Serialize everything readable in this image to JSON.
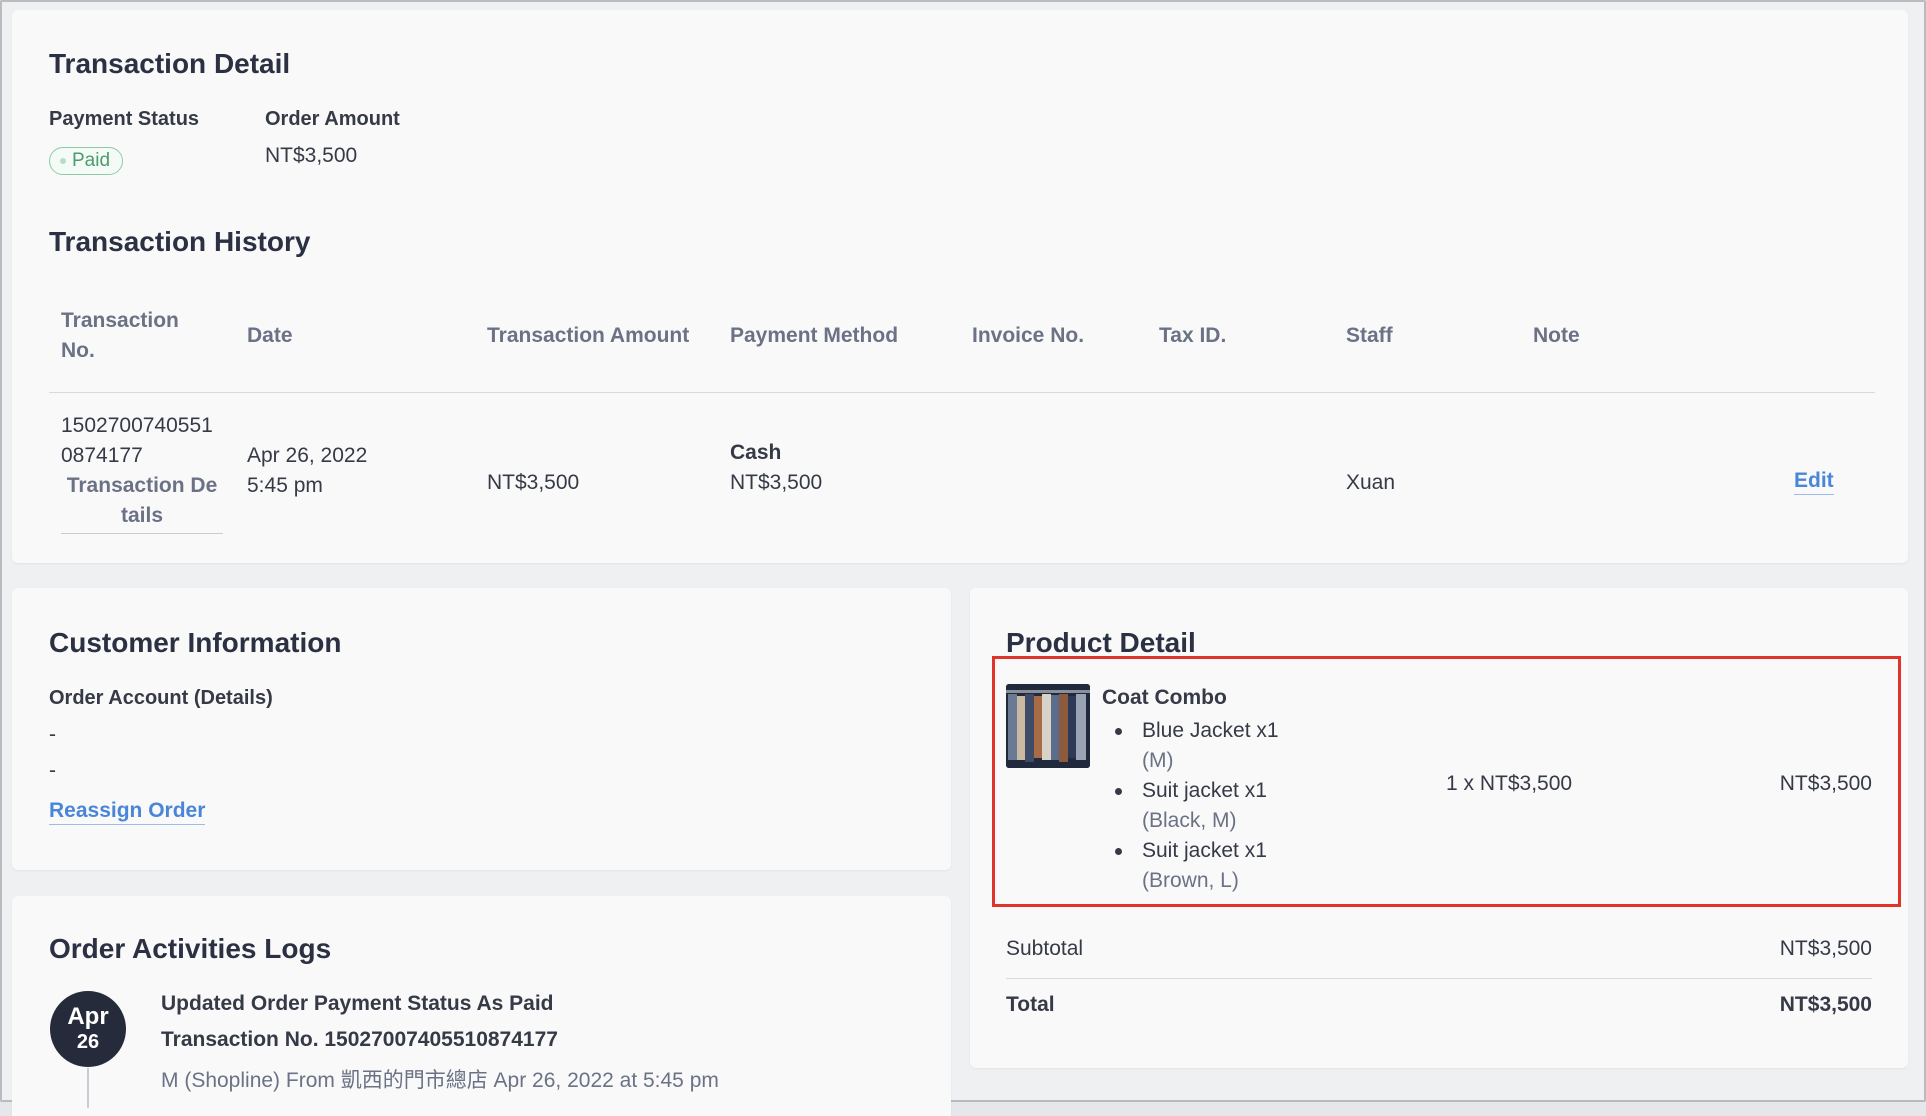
{
  "transaction_detail": {
    "title": "Transaction Detail",
    "payment_status_label": "Payment Status",
    "payment_status_value": "Paid",
    "order_amount_label": "Order Amount",
    "order_amount_value": "NT$3,500"
  },
  "transaction_history": {
    "title": "Transaction History",
    "columns": {
      "no_line1": "Transaction",
      "no_line2": "No.",
      "date": "Date",
      "amount": "Transaction Amount",
      "method": "Payment Method",
      "invoice": "Invoice No.",
      "tax": "Tax ID.",
      "staff": "Staff",
      "note": "Note"
    },
    "row": {
      "no_line1": "1502700740551",
      "no_line2": "0874177",
      "details_line1": "Transaction De",
      "details_line2": "tails",
      "date_line1": "Apr 26, 2022",
      "date_line2": "5:45 pm",
      "amount": "NT$3,500",
      "method": "Cash",
      "method_amount": "NT$3,500",
      "staff": "Xuan",
      "edit": "Edit"
    }
  },
  "customer": {
    "title": "Customer Information",
    "order_account_label": "Order Account (Details)",
    "line1": "-",
    "line2": "-",
    "reassign": "Reassign Order"
  },
  "activity": {
    "title": "Order Activities Logs",
    "month": "Apr",
    "day": "26",
    "line1": "Updated Order Payment Status As Paid",
    "line2": "Transaction No. 15027007405510874177",
    "line3": "M (Shopline) From 凱西的門市總店 Apr 26, 2022 at 5:45 pm"
  },
  "product": {
    "title": "Product Detail",
    "name": "Coat Combo",
    "items": [
      {
        "name": "Blue Jacket x1",
        "variant": "(M)"
      },
      {
        "name": "Suit jacket x1",
        "variant": "(Black, M)"
      },
      {
        "name": "Suit jacket x1",
        "variant": "(Brown, L)"
      }
    ],
    "unit_price": "1 x NT$3,500",
    "line_total": "NT$3,500",
    "subtotal_label": "Subtotal",
    "subtotal_value": "NT$3,500",
    "total_label": "Total",
    "total_value": "NT$3,500"
  },
  "colors": {
    "accent_link": "#4a86d8",
    "paid_badge": "#4c9b6e",
    "highlight_box": "#e0342a"
  }
}
